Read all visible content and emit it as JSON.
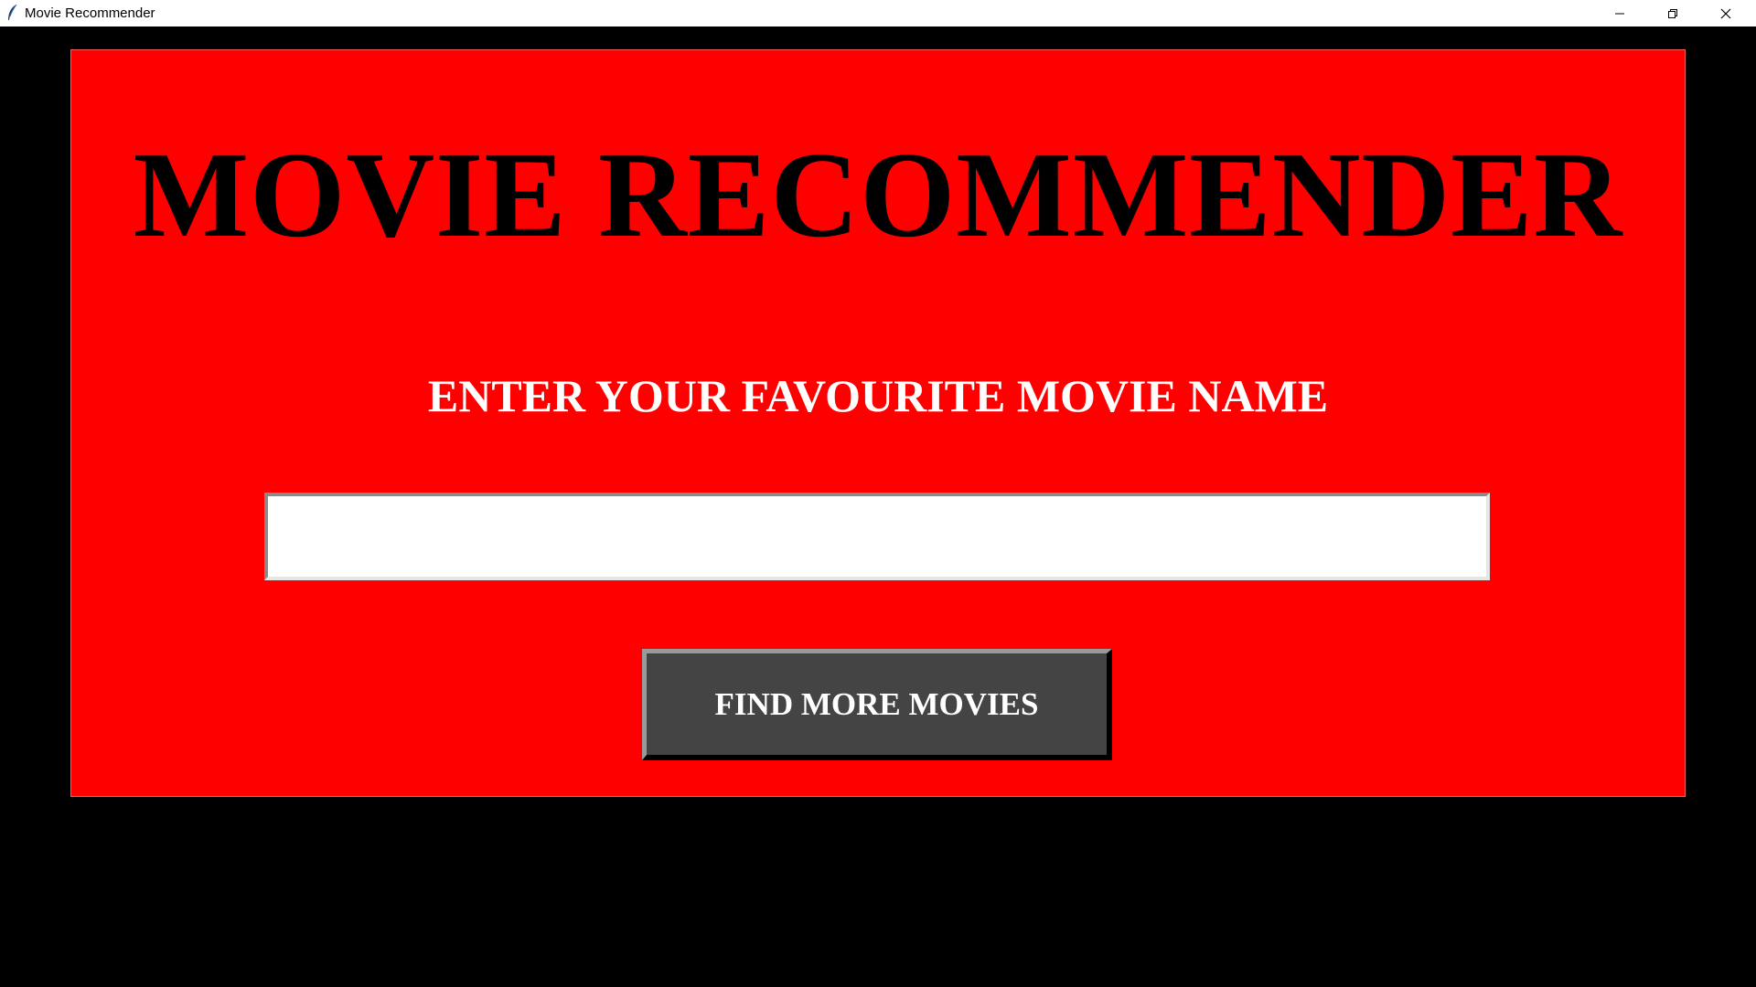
{
  "window": {
    "title": "Movie Recommender",
    "app_icon": "feather-icon",
    "controls": {
      "minimize_icon": "minimize-icon",
      "restore_icon": "restore-icon",
      "close_icon": "close-icon"
    }
  },
  "main": {
    "title": "MOVIE RECOMMENDER",
    "prompt": "ENTER YOUR FAVOURITE MOVIE NAME",
    "movie_input": {
      "value": "",
      "placeholder": ""
    },
    "find_button_label": "FIND MORE MOVIES"
  },
  "colors": {
    "background": "#000000",
    "panel": "#ff0000",
    "title_text": "#000000",
    "prompt_text": "#ffffff",
    "button_bg": "#444444",
    "button_text": "#ffffff",
    "input_bg": "#ffffff"
  }
}
